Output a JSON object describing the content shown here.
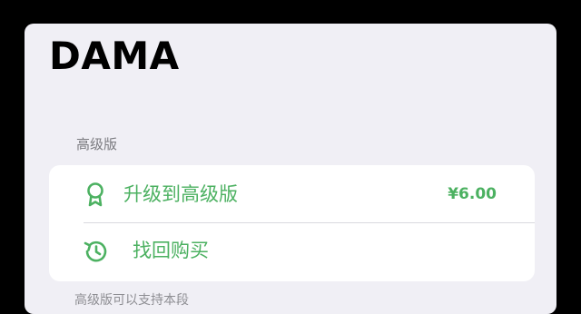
{
  "app": {
    "title": "DAMA"
  },
  "premium_section": {
    "header": "高级版",
    "rows": [
      {
        "label": "升级到高级版",
        "icon": "award-ribbon-icon",
        "price": "¥6.00"
      },
      {
        "label": "找回购买",
        "icon": "history-clock-icon"
      }
    ]
  },
  "footer_note": "高级版可以支持本段",
  "colors": {
    "accent": "#4cb161",
    "background": "#f0eff5",
    "card": "#ffffff",
    "secondary_text": "#7b7b80"
  }
}
